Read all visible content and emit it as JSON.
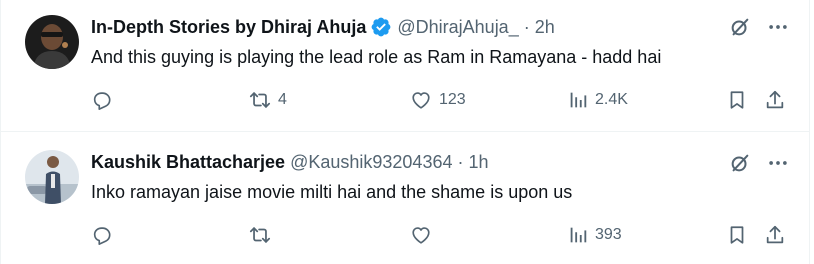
{
  "tweets": [
    {
      "name": "In-Depth Stories by Dhiraj Ahuja",
      "verified": true,
      "handle": "@DhirajAhuja_",
      "separator": "·",
      "time": "2h",
      "text": "And this guying is playing the lead role as Ram in Ramayana - hadd hai",
      "retweets": "4",
      "likes": "123",
      "views": "2.4K"
    },
    {
      "name": "Kaushik Bhattacharjee",
      "verified": false,
      "handle": "@Kaushik93204364",
      "separator": "·",
      "time": "1h",
      "text": "Inko ramayan jaise movie milti hai and the shame is upon us",
      "retweets": "",
      "likes": "",
      "views": "393"
    }
  ],
  "icons": {
    "reply": "reply-icon",
    "retweet": "retweet-icon",
    "like": "heart-icon",
    "views": "views-icon",
    "bookmark": "bookmark-icon",
    "share": "share-icon",
    "grok": "grok-icon",
    "more": "more-icon",
    "verified": "verified-badge-icon"
  },
  "colors": {
    "text": "#0f1419",
    "secondary": "#536471",
    "verified": "#1d9bf0",
    "divider": "#eff3f4"
  }
}
